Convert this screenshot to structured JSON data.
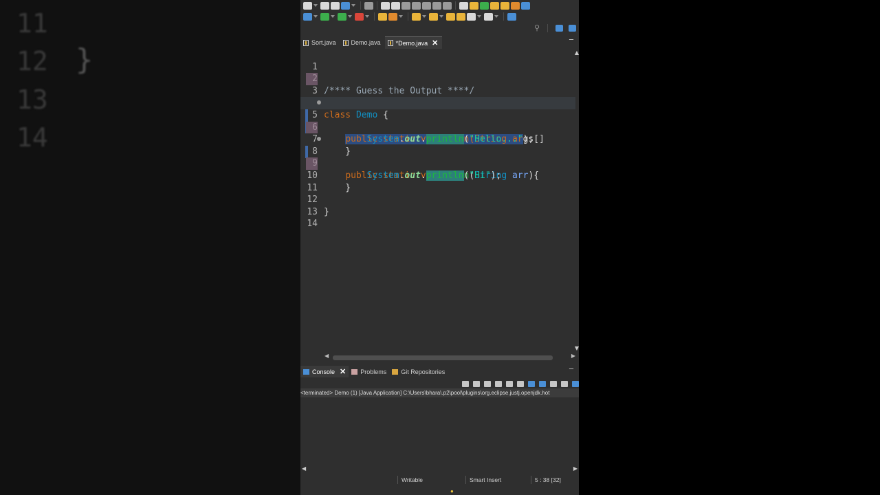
{
  "backdrop": {
    "line_numbers": [
      "11",
      "12",
      "13",
      "14"
    ],
    "brace": "}"
  },
  "editor_tabs": [
    {
      "label": "Sort.java",
      "active": false
    },
    {
      "label": "Demo.java",
      "active": false
    },
    {
      "label": "*Demo.java",
      "active": true,
      "close": "✕"
    }
  ],
  "editor": {
    "line_numbers": [
      "1",
      "2",
      "3",
      "4",
      "5",
      "6",
      "7",
      "8",
      "9",
      "10",
      "11",
      "12",
      "13",
      "14"
    ],
    "lines": {
      "l2_comment": "/**** Guess the Output ****/",
      "l4_class_kw": "class",
      "l4_class_name": "Demo",
      "l4_brace": " {",
      "l5_indent": "    ",
      "l5_sel": "public static void main(String ar",
      "l5_rest": "gs[]",
      "l6_indent": "        ",
      "l6_system": "System",
      "l6_dot1": ".",
      "l6_out": "out",
      "l6_dot2": ".",
      "l6_println": "println",
      "l6_open": "(",
      "l6_str": "\"Hello...\"",
      "l6_close": ");",
      "l7": "    }",
      "l8_indent": "    ",
      "l8_public": "public",
      "l8_static": "static",
      "l8_void": "void",
      "l8_main": "main",
      "l8_open": "(",
      "l8_string": "String",
      "l8_arr": "arr",
      "l8_close": "){",
      "l9_indent": "        ",
      "l9_system": "System",
      "l9_dot1": ".",
      "l9_out": "out",
      "l9_dot2": ".",
      "l9_println": "println",
      "l9_open": "(",
      "l9_str": "\"Hi\"",
      "l9_close": ");",
      "l10": "    }",
      "l12": "}"
    }
  },
  "panel_tabs": [
    {
      "label": "Console",
      "active": true,
      "close": "✕"
    },
    {
      "label": "Problems",
      "active": false
    },
    {
      "label": "Git Repositories",
      "active": false
    }
  ],
  "console": {
    "status": "<terminated> Demo (1) [Java Application] C:\\Users\\bhara\\.p2\\pool\\plugins\\org.eclipse.justj.openjdk.hot"
  },
  "statusbar": {
    "writable": "Writable",
    "insert_mode": "Smart Insert",
    "position": "5 : 38 [32]"
  },
  "colors": {
    "ide_bg": "#2f2f2f",
    "keyword": "#cc6c1d",
    "type": "#1290c3",
    "method": "#1eb540",
    "string": "#17c6a3",
    "selection": "#2c4d82"
  }
}
